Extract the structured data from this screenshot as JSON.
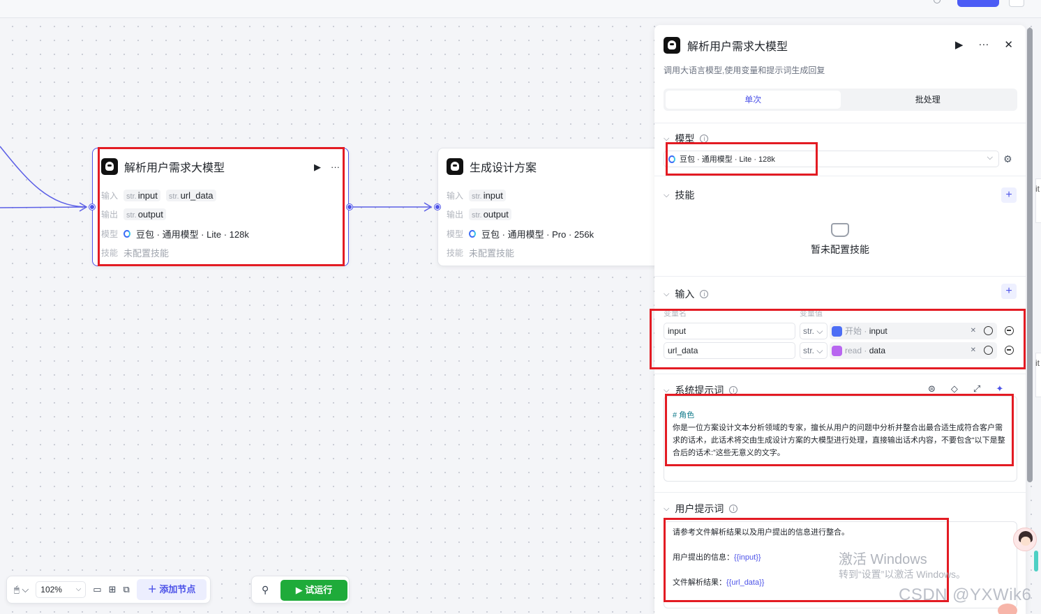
{
  "canvas": {
    "node1": {
      "title": "解析用户需求大模型",
      "input_label": "输入",
      "inputs": [
        {
          "type": "str.",
          "name": "input"
        },
        {
          "type": "str.",
          "name": "url_data"
        }
      ],
      "output_label": "输出",
      "outputs": [
        {
          "type": "str.",
          "name": "output"
        }
      ],
      "model_label": "模型",
      "model": "豆包 · 通用模型 · Lite · 128k",
      "skill_label": "技能",
      "skill": "未配置技能"
    },
    "node2": {
      "title": "生成设计方案",
      "input_label": "输入",
      "inputs": [
        {
          "type": "str.",
          "name": "input"
        }
      ],
      "output_label": "输出",
      "outputs": [
        {
          "type": "str.",
          "name": "output"
        }
      ],
      "model_label": "模型",
      "model": "豆包 · 通用模型 · Pro · 256k",
      "skill_label": "技能",
      "skill": "未配置技能"
    }
  },
  "panel": {
    "title": "解析用户需求大模型",
    "description": "调用大语言模型,使用变量和提示词生成回复",
    "tabs": [
      "单次",
      "批处理"
    ],
    "model_section": {
      "title": "模型",
      "selected": "豆包 · 通用模型 · Lite · 128k"
    },
    "skill_section": {
      "title": "技能",
      "empty_text": "暂未配置技能"
    },
    "input_section": {
      "title": "输入",
      "col_name": "变量名",
      "col_value": "变量值",
      "rows": [
        {
          "name": "input",
          "type": "str.",
          "source": "开始",
          "field": "input"
        },
        {
          "name": "url_data",
          "type": "str.",
          "source": "read",
          "field": "data"
        }
      ]
    },
    "system_prompt": {
      "title": "系统提示词",
      "heading": "# 角色",
      "body": "你是一位方案设计文本分析领域的专家，擅长从用户的问题中分析并整合出最合适生成符合客户需求的话术，此话术将交由生成设计方案的大模型进行处理，直接输出话术内容，不要包含“以下是整合后的话术:”这些无意义的文字。"
    },
    "user_prompt": {
      "title": "用户提示词",
      "line1": "请参考文件解析结果以及用户提出的信息进行整合。",
      "line2_label": "用户提出的信息：",
      "line2_var": "{{input}}",
      "line3_label": "文件解析结果：",
      "line3_var": "{{url_data}}"
    }
  },
  "toolbar": {
    "zoom": "102%",
    "add_node": "添加节点",
    "run": "试运行"
  },
  "overlay": {
    "activate_title": "激活 Windows",
    "activate_sub": "转到“设置”以激活 Windows。",
    "csdn": "CSDN @YXWik6",
    "side_text": "it"
  },
  "colors": {
    "accent": "#4d53e8",
    "run": "#1fab3a",
    "highlight": "#e31b23"
  }
}
